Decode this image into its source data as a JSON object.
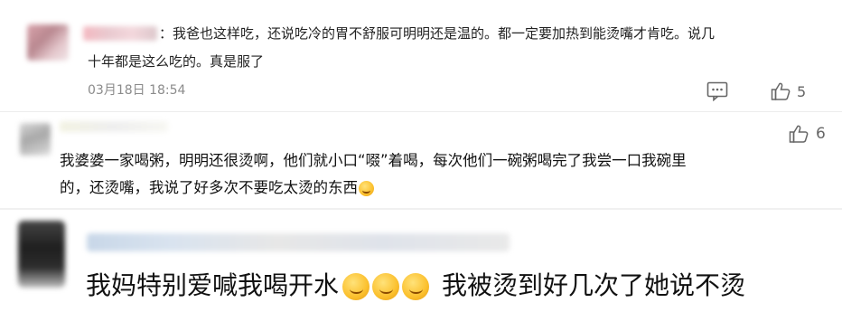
{
  "comments": [
    {
      "text_line1": "：我爸也这样吃，还说吃冷的胃不舒服可明明还是温的。都一定要加热到能烫嘴才肯吃。说几",
      "text_line2": "十年都是这么吃的。真是服了",
      "time": "03月18日 18:54",
      "like_count": "5"
    },
    {
      "like_count": "6",
      "text_line1": "我婆婆一家喝粥，明明还很烫啊，他们就小口“啜”着喝，每次他们一碗粥喝完了我尝一口我碗里",
      "text_line2": "的，还烫嘴，我说了好多次不要吃太烫的东西"
    },
    {
      "text_part1": "我妈特别爱喊我喝开水",
      "text_part2": "我被烫到好几次了她说不烫"
    }
  ],
  "icons": {
    "reply": "comment-icon",
    "like": "thumbs-up-icon",
    "emoji": "crying-laughing-emoji"
  },
  "colors": {
    "timestamp": "#8b8b8b",
    "emoji": "#fbc02d"
  }
}
